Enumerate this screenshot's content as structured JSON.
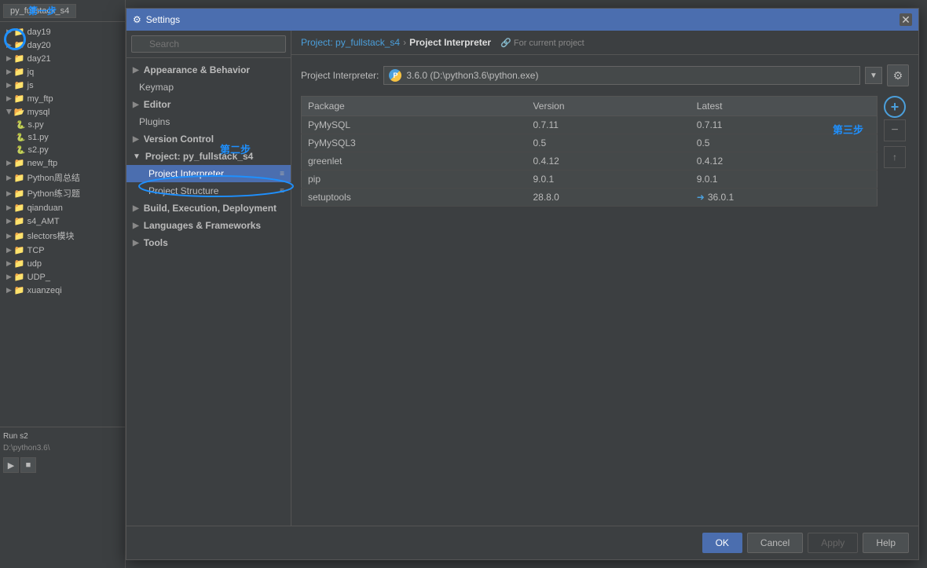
{
  "dialog": {
    "title": "Settings",
    "title_icon": "⚙",
    "close_btn": "✕"
  },
  "search": {
    "placeholder": "Search"
  },
  "breadcrumb": {
    "project": "Project: py_fullstack_s4",
    "separator": "›",
    "current": "Project Interpreter",
    "note": "For current project"
  },
  "interpreter": {
    "label": "Project Interpreter:",
    "value": "3.6.0 (D:\\python3.6\\python.exe)",
    "dropdown_icon": "▼"
  },
  "table": {
    "headers": [
      "Package",
      "Version",
      "Latest"
    ],
    "rows": [
      {
        "package": "PyMySQL",
        "version": "0.7.11",
        "latest": "0.7.11",
        "has_update": false
      },
      {
        "package": "PyMySQL3",
        "version": "0.5",
        "latest": "0.5",
        "has_update": false
      },
      {
        "package": "greenlet",
        "version": "0.4.12",
        "latest": "0.4.12",
        "has_update": false
      },
      {
        "package": "pip",
        "version": "9.0.1",
        "latest": "9.0.1",
        "has_update": false
      },
      {
        "package": "setuptools",
        "version": "28.8.0",
        "latest": "36.0.1",
        "has_update": true
      }
    ]
  },
  "nav": {
    "items": [
      {
        "id": "appearance",
        "label": "Appearance & Behavior",
        "level": "section",
        "has_arrow": true
      },
      {
        "id": "keymap",
        "label": "Keymap",
        "level": "top"
      },
      {
        "id": "editor",
        "label": "Editor",
        "level": "section",
        "has_arrow": true
      },
      {
        "id": "plugins",
        "label": "Plugins",
        "level": "top"
      },
      {
        "id": "version-control",
        "label": "Version Control",
        "level": "section",
        "has_arrow": true
      },
      {
        "id": "project",
        "label": "Project: py_fullstack_s4",
        "level": "section",
        "has_arrow": true
      },
      {
        "id": "project-interpreter",
        "label": "Project Interpreter",
        "level": "sub",
        "active": true
      },
      {
        "id": "project-structure",
        "label": "Project Structure",
        "level": "sub"
      },
      {
        "id": "build",
        "label": "Build, Execution, Deployment",
        "level": "section",
        "has_arrow": true
      },
      {
        "id": "languages",
        "label": "Languages & Frameworks",
        "level": "section",
        "has_arrow": true
      },
      {
        "id": "tools",
        "label": "Tools",
        "level": "section",
        "has_arrow": true
      }
    ]
  },
  "footer": {
    "ok_label": "OK",
    "cancel_label": "Cancel",
    "apply_label": "Apply",
    "help_label": "Help"
  },
  "ide": {
    "project_name": "py_fullstack_s4",
    "tree_items": [
      {
        "name": "day19",
        "type": "folder",
        "expanded": false
      },
      {
        "name": "day20",
        "type": "folder",
        "expanded": false
      },
      {
        "name": "day21",
        "type": "folder",
        "expanded": false
      },
      {
        "name": "jq",
        "type": "folder",
        "expanded": false
      },
      {
        "name": "js",
        "type": "folder",
        "expanded": false
      },
      {
        "name": "my_ftp",
        "type": "folder",
        "expanded": false
      },
      {
        "name": "mysql",
        "type": "folder",
        "expanded": true
      },
      {
        "name": "s.py",
        "type": "file",
        "parent": "mysql"
      },
      {
        "name": "s1.py",
        "type": "file",
        "parent": "mysql"
      },
      {
        "name": "s2.py",
        "type": "file",
        "parent": "mysql"
      },
      {
        "name": "new_ftp",
        "type": "folder",
        "expanded": false
      },
      {
        "name": "Python周总结",
        "type": "folder",
        "expanded": false
      },
      {
        "name": "Python练习题",
        "type": "folder",
        "expanded": false
      },
      {
        "name": "qianduan",
        "type": "folder",
        "expanded": false
      },
      {
        "name": "s4_AMT",
        "type": "folder",
        "expanded": false
      },
      {
        "name": "slectors模块",
        "type": "folder",
        "expanded": false
      },
      {
        "name": "TCP",
        "type": "folder",
        "expanded": false
      },
      {
        "name": "udp",
        "type": "folder",
        "expanded": false
      },
      {
        "name": "UDP_",
        "type": "folder",
        "expanded": false
      },
      {
        "name": "xuanzeqi",
        "type": "folder",
        "expanded": false
      }
    ]
  },
  "annotations": {
    "step1_text": "第一步",
    "step2_text": "第二步",
    "step3_text": "第三步"
  }
}
